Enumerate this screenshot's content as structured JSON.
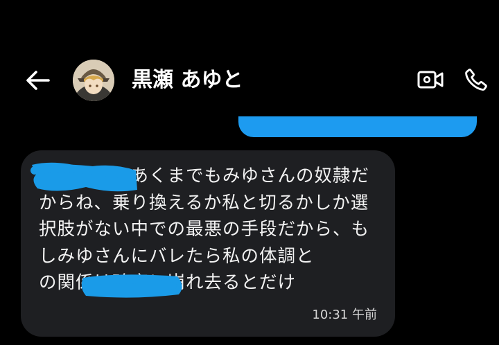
{
  "header": {
    "contact_name": "黒瀬 あゆと",
    "back_icon": "arrow-left-icon",
    "video_icon": "video-call-icon",
    "call_icon": "phone-icon"
  },
  "messages": {
    "sent_color": "#1d9bf0",
    "received": {
      "text": "　　　　はあくまでもみゆさんの奴隷だからね、乗り換えるか私と切るかしか選択肢がない中での最悪の手段だから、もしみゆさんにバレたら私の体調と　　　　　　の関係は確実に崩れ去るとだけ",
      "time": "10:31 午前"
    }
  },
  "redaction_color": "#1a9be8"
}
